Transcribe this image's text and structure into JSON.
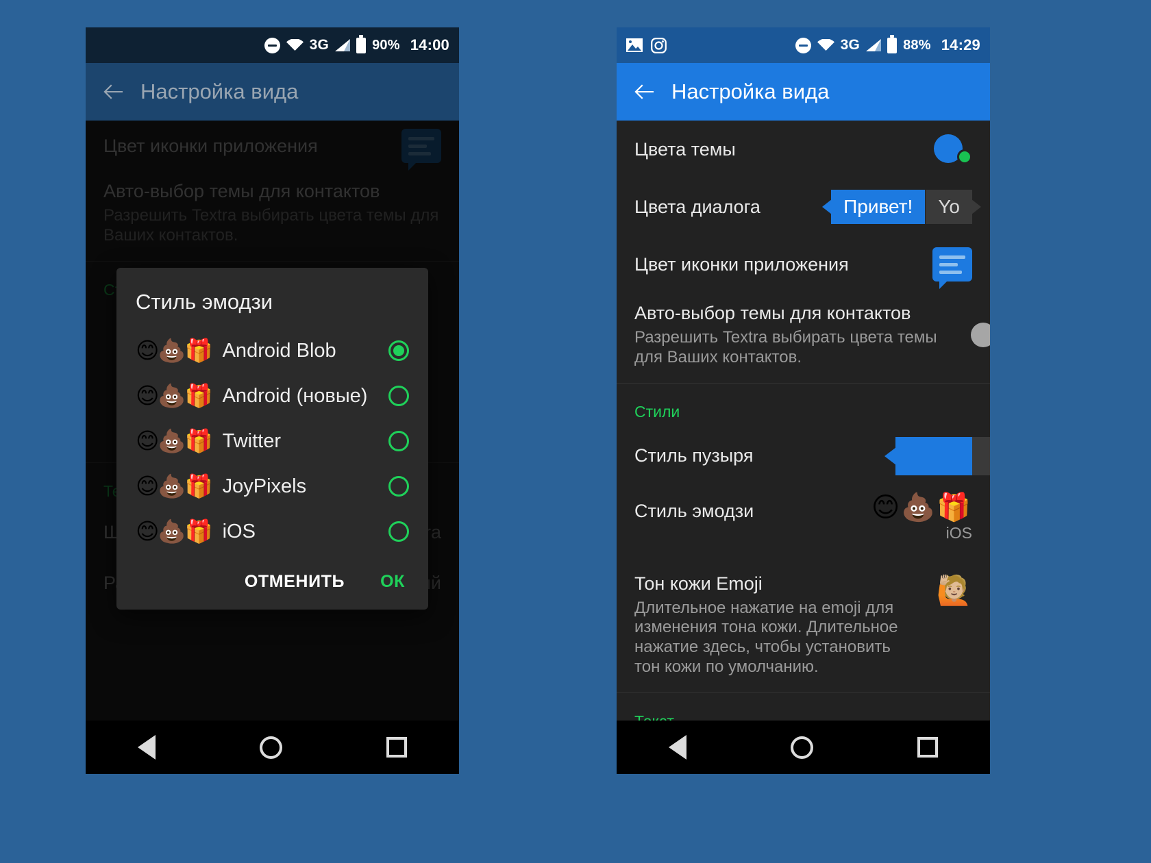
{
  "left_phone": {
    "statusbar": {
      "icons": [
        "dnd-icon",
        "wifi-icon",
        "network-3g-icon",
        "signal-icon",
        "battery-icon"
      ],
      "network": "3G",
      "battery_percent": "90%",
      "clock": "14:00"
    },
    "appbar": {
      "back_icon": "back-arrow-icon",
      "title": "Настройка вида"
    },
    "rows": [
      {
        "label": "Цвет иконки приложения",
        "widget": "app-icon"
      },
      {
        "label": "Авто-выбор темы для контактов",
        "sub": "Разрешить Textra выбирать цвета темы для Ваших контактов.",
        "widget": "toggle"
      }
    ],
    "section_styles": "Стили",
    "section_text": "Текст",
    "text_rows": [
      {
        "label": "Шрифт текста",
        "value": "Textra"
      },
      {
        "label": "Размер шрифта",
        "value": "Средний"
      }
    ],
    "dialog": {
      "title": "Стиль эмодзи",
      "options": [
        {
          "emoji": "😊💩🎁",
          "label": "Android Blob",
          "selected": true
        },
        {
          "emoji": "😊💩🎁",
          "label": "Android (новые)",
          "selected": false
        },
        {
          "emoji": "😊💩🎁",
          "label": "Twitter",
          "selected": false
        },
        {
          "emoji": "😊💩🎁",
          "label": "JoyPixels",
          "selected": false
        },
        {
          "emoji": "😊💩🎁",
          "label": "iOS",
          "selected": false
        }
      ],
      "cancel_label": "ОТМЕНИТЬ",
      "ok_label": "ОК"
    },
    "navbar": {
      "back": "nav-back-icon",
      "home": "nav-home-icon",
      "recents": "nav-recents-icon"
    }
  },
  "right_phone": {
    "statusbar": {
      "left_icons": [
        "photo-icon",
        "instagram-icon"
      ],
      "icons": [
        "dnd-icon",
        "wifi-icon",
        "network-3g-icon",
        "signal-icon",
        "battery-icon"
      ],
      "network": "3G",
      "battery_percent": "88%",
      "clock": "14:29"
    },
    "appbar": {
      "back_icon": "back-arrow-icon",
      "title": "Настройка вида"
    },
    "rows": [
      {
        "label": "Цвета темы",
        "widget": "theme-dots"
      },
      {
        "label": "Цвета диалога",
        "widget": "dialog-bubbles",
        "bubble_in": "Привет!",
        "bubble_out": "Yo"
      },
      {
        "label": "Цвет иконки приложения",
        "widget": "app-icon"
      }
    ],
    "auto_theme": {
      "label": "Авто-выбор темы для контактов",
      "sub": "Разрешить Textra выбирать цвета темы для Ваших контактов.",
      "widget": "toggle"
    },
    "section_styles": "Стили",
    "style_rows": [
      {
        "label": "Стиль пузыря",
        "widget": "bubble-style"
      },
      {
        "label": "Стиль эмодзи",
        "widget": "emoji-trio",
        "emoji": "😊💩🎁",
        "caption": "iOS"
      }
    ],
    "skin_tone": {
      "label": "Тон кожи Emoji",
      "sub": "Длительное нажатие на emoji для изменения тона кожи. Длительное нажатие здесь, чтобы установить тон кожи по умолчанию.",
      "emoji": "🙋🏼"
    },
    "section_text": "Текст",
    "navbar": {
      "back": "nav-back-icon",
      "home": "nav-home-icon",
      "recents": "nav-recents-icon"
    }
  },
  "colors": {
    "page_background": "#2b6298",
    "accent_blue": "#1d7ae0",
    "accent_green": "#1fd15a",
    "dark_surface": "#222222",
    "dialog_surface": "#2b2b2b",
    "left_appbar": "#1c456e",
    "left_statusbar": "#0e2133",
    "right_statusbar": "#1b5797"
  }
}
